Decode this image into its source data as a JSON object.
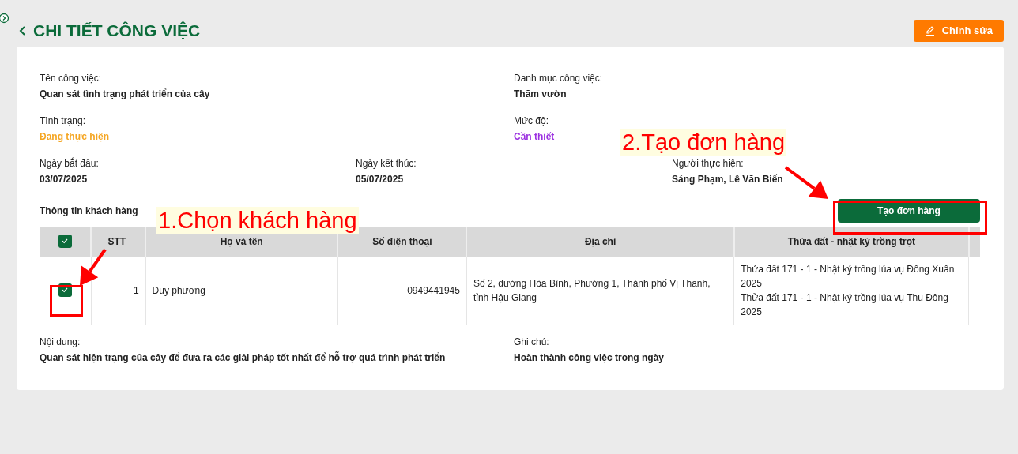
{
  "header": {
    "title": "CHI TIẾT CÔNG VIỆC",
    "edit_button": "Chỉnh sửa"
  },
  "field_rows": [
    [
      {
        "label": "Tên công việc:",
        "value": "Quan sát tình trạng phát triển của cây"
      },
      {
        "label": "Danh mục công việc:",
        "value": "Thăm vườn"
      }
    ],
    [
      {
        "label": "Tình trạng:",
        "value": "Đang thực hiện",
        "color": "#f5a623"
      },
      {
        "label": "Mức độ:",
        "value": "Cần thiết",
        "color": "#9b30e0"
      }
    ],
    [
      {
        "label": "Ngày bắt đầu:",
        "value": "03/07/2025"
      },
      {
        "label": "Ngày kết thúc:",
        "value": "05/07/2025"
      },
      {
        "label": "Người thực hiện:",
        "value": "Sáng Phạm, Lê Văn Biển"
      }
    ]
  ],
  "customers": {
    "title": "Thông tin khách hàng",
    "create_button": "Tạo đơn hàng",
    "select_all": {
      "checked": true
    },
    "columns": [
      "STT",
      "Họ và tên",
      "Số điện thoại",
      "Địa chỉ",
      "Thửa đất - nhật ký trồng trọt"
    ],
    "rows": [
      {
        "checked": true,
        "stt": "1",
        "name": "Duy phương",
        "phone": "0949441945",
        "address": "Số 2, đường Hòa Bình, Phường 1, Thành phố Vị Thanh, tỉnh Hậu Giang",
        "plots": [
          "Thửa đất 171 - 1 - Nhật ký trồng lúa vụ Đông Xuân 2025",
          "Thửa đất 171 - 1 - Nhật ký trồng lúa vụ Thu Đông 2025"
        ]
      }
    ]
  },
  "notes": [
    {
      "label": "Nội dung:",
      "value": "Quan sát hiện trạng của cây để đưa ra các giải pháp tốt nhất để hỗ trợ quá trình phát triển"
    },
    {
      "label": "Ghi chú:",
      "value": "Hoàn thành công việc trong ngày"
    }
  ],
  "annotations": [
    {
      "text": "1.Chọn khách hàng"
    },
    {
      "text": "2.Tạo đơn hàng"
    }
  ]
}
